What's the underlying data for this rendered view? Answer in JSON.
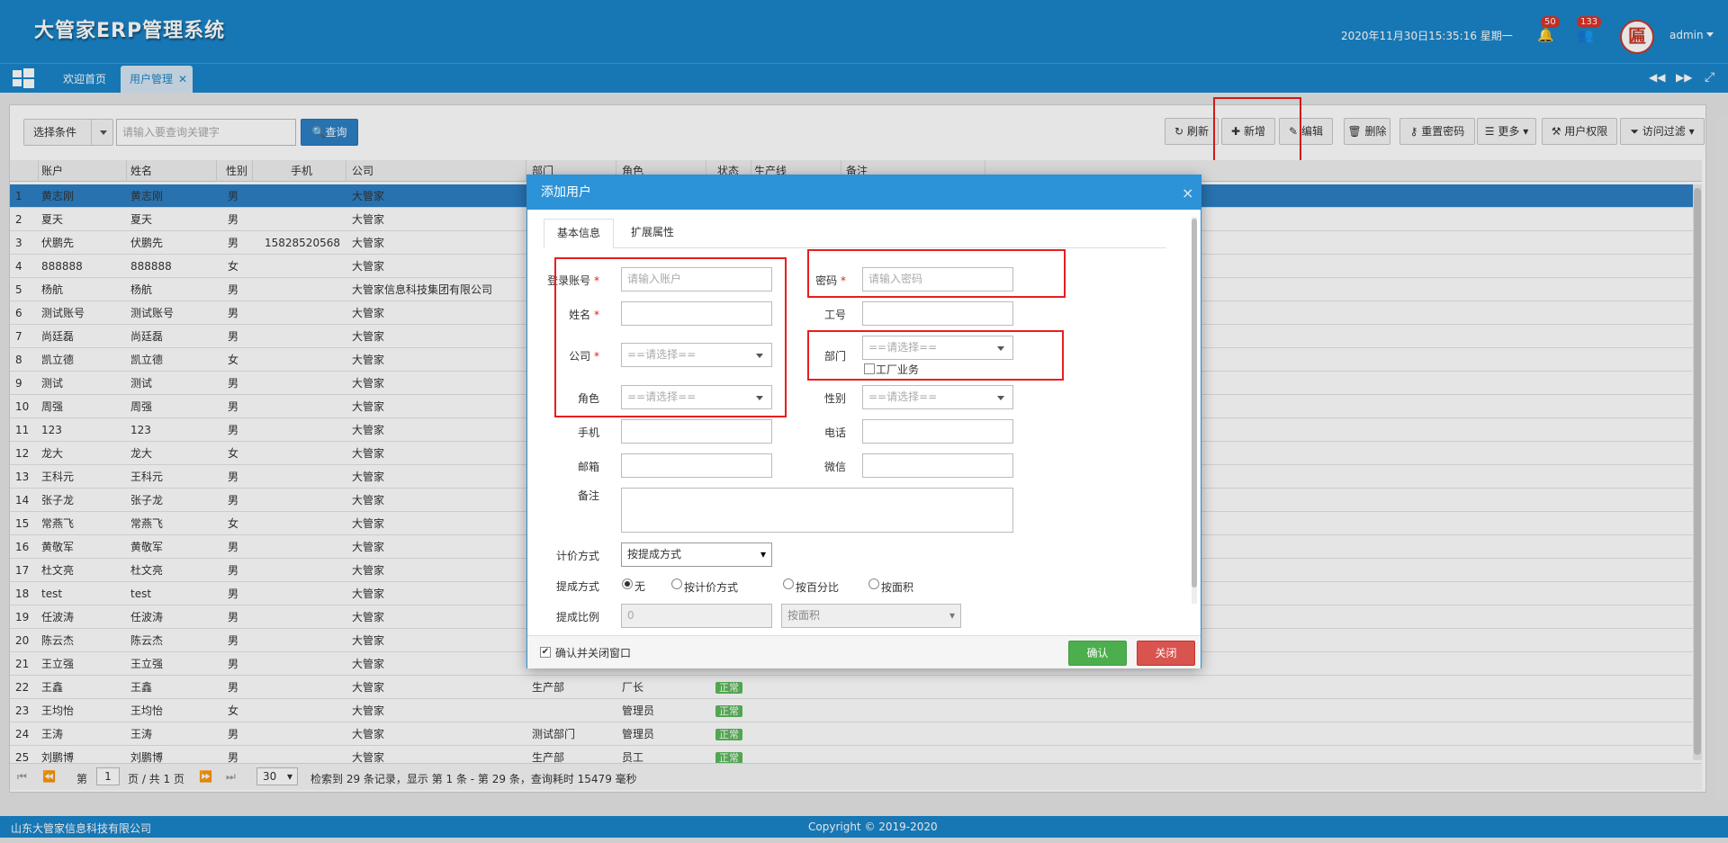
{
  "header": {
    "app_title": "大管家ERP管理系统",
    "datetime": "2020年11月30日15:35:16 星期一",
    "bell_count": "50",
    "user_count": "133",
    "avatar_text": "匾",
    "username": "admin",
    "colors": {
      "primary": "#1a85c9",
      "badge": "#d9342b"
    }
  },
  "tabs": [
    {
      "label": "欢迎首页"
    },
    {
      "label": "用户管理"
    }
  ],
  "toolbar": {
    "filter_label": "选择条件",
    "search_placeholder": "请输入要查询关键字",
    "query_label": "查询",
    "refresh": "刷新",
    "add": "新增",
    "edit": "编辑",
    "delete": "删除",
    "reset_pwd": "重置密码",
    "more": "更多",
    "user_perm": "用户权限",
    "access_filter": "访问过滤"
  },
  "grid": {
    "columns": [
      "账户",
      "姓名",
      "性别",
      "手机",
      "公司",
      "部门",
      "角色",
      "状态",
      "生产线",
      "备注"
    ],
    "rows": [
      [
        "1",
        "黄志刚",
        "黄志刚",
        "男",
        "",
        "大管家",
        "",
        "",
        ""
      ],
      [
        "2",
        "夏天",
        "夏天",
        "男",
        "",
        "大管家",
        "",
        "",
        ""
      ],
      [
        "3",
        "伏鹏先",
        "伏鹏先",
        "男",
        "15828520568",
        "大管家",
        "",
        "",
        ""
      ],
      [
        "4",
        "888888",
        "888888",
        "女",
        "",
        "大管家",
        "",
        "",
        ""
      ],
      [
        "5",
        "杨航",
        "杨航",
        "男",
        "",
        "大管家信息科技集团有限公司",
        "",
        "",
        ""
      ],
      [
        "6",
        "测试账号",
        "测试账号",
        "男",
        "",
        "大管家",
        "",
        "",
        ""
      ],
      [
        "7",
        "尚廷磊",
        "尚廷磊",
        "男",
        "",
        "大管家",
        "",
        "",
        ""
      ],
      [
        "8",
        "凯立德",
        "凯立德",
        "女",
        "",
        "大管家",
        "",
        "",
        ""
      ],
      [
        "9",
        "测试",
        "测试",
        "男",
        "",
        "大管家",
        "",
        "",
        ""
      ],
      [
        "10",
        "周强",
        "周强",
        "男",
        "",
        "大管家",
        "",
        "",
        ""
      ],
      [
        "11",
        "123",
        "123",
        "男",
        "",
        "大管家",
        "",
        "",
        ""
      ],
      [
        "12",
        "龙大",
        "龙大",
        "女",
        "",
        "大管家",
        "",
        "",
        ""
      ],
      [
        "13",
        "王科元",
        "王科元",
        "男",
        "",
        "大管家",
        "",
        "",
        ""
      ],
      [
        "14",
        "张子龙",
        "张子龙",
        "男",
        "",
        "大管家",
        "",
        "",
        ""
      ],
      [
        "15",
        "常燕飞",
        "常燕飞",
        "女",
        "",
        "大管家",
        "",
        "",
        ""
      ],
      [
        "16",
        "黄敬军",
        "黄敬军",
        "男",
        "",
        "大管家",
        "",
        "",
        ""
      ],
      [
        "17",
        "杜文亮",
        "杜文亮",
        "男",
        "",
        "大管家",
        "",
        "",
        ""
      ],
      [
        "18",
        "test",
        "test",
        "男",
        "",
        "大管家",
        "",
        "",
        ""
      ],
      [
        "19",
        "任波涛",
        "任波涛",
        "男",
        "",
        "大管家",
        "",
        "",
        ""
      ],
      [
        "20",
        "陈云杰",
        "陈云杰",
        "男",
        "",
        "大管家",
        "",
        "",
        ""
      ],
      [
        "21",
        "王立强",
        "王立强",
        "男",
        "",
        "大管家",
        "",
        "",
        ""
      ],
      [
        "22",
        "王鑫",
        "王鑫",
        "男",
        "",
        "大管家",
        "生产部",
        "厂长",
        "正常"
      ],
      [
        "23",
        "王均怡",
        "王均怡",
        "女",
        "",
        "大管家",
        "",
        "管理员",
        "正常"
      ],
      [
        "24",
        "王涛",
        "王涛",
        "男",
        "",
        "大管家",
        "测试部门",
        "管理员",
        "正常"
      ],
      [
        "25",
        "刘鹏博",
        "刘鹏博",
        "男",
        "",
        "大管家",
        "生产部",
        "员工",
        "正常"
      ]
    ]
  },
  "pager": {
    "page_prefix": "第",
    "page_value": "1",
    "page_suffix": "页 / 共 1 页",
    "page_size": "30",
    "info": "检索到 29 条记录，显示 第 1 条 - 第 29 条，查询耗时 15479 毫秒"
  },
  "footer": {
    "company": "山东大管家信息科技有限公司",
    "copyright": "Copyright © 2019-2020"
  },
  "dialog": {
    "title": "添加用户",
    "tab_basic": "基本信息",
    "tab_ext": "扩展属性",
    "account_label": "登录账号",
    "account_placeholder": "请输入账户",
    "password_label": "密码",
    "password_placeholder": "请输入密码",
    "name_label": "姓名",
    "jobno_label": "工号",
    "company_label": "公司",
    "company_select": "==请选择==",
    "dept_label": "部门",
    "dept_select": "==请选择==",
    "factory_label": "工厂业务",
    "role_label": "角色",
    "role_select": "==请选择==",
    "gender_label": "性别",
    "gender_select": "==请选择==",
    "mobile_label": "手机",
    "phone_label": "电话",
    "email_label": "邮箱",
    "wechat_label": "微信",
    "remark_label": "备注",
    "pricing_label": "计价方式",
    "pricing_value": "按提成方式",
    "commission_label": "提成方式",
    "commission_options": [
      "无",
      "按计价方式",
      "按百分比",
      "按面积"
    ],
    "ratio_label": "提成比例",
    "ratio_value": "0",
    "ratio_select": "按面积",
    "confirm_close_label": "确认并关闭窗口",
    "ok": "确认",
    "close": "关闭",
    "colors": {
      "ok": "#4cae4c",
      "close": "#d9534f",
      "title": "#2d93d8"
    }
  }
}
